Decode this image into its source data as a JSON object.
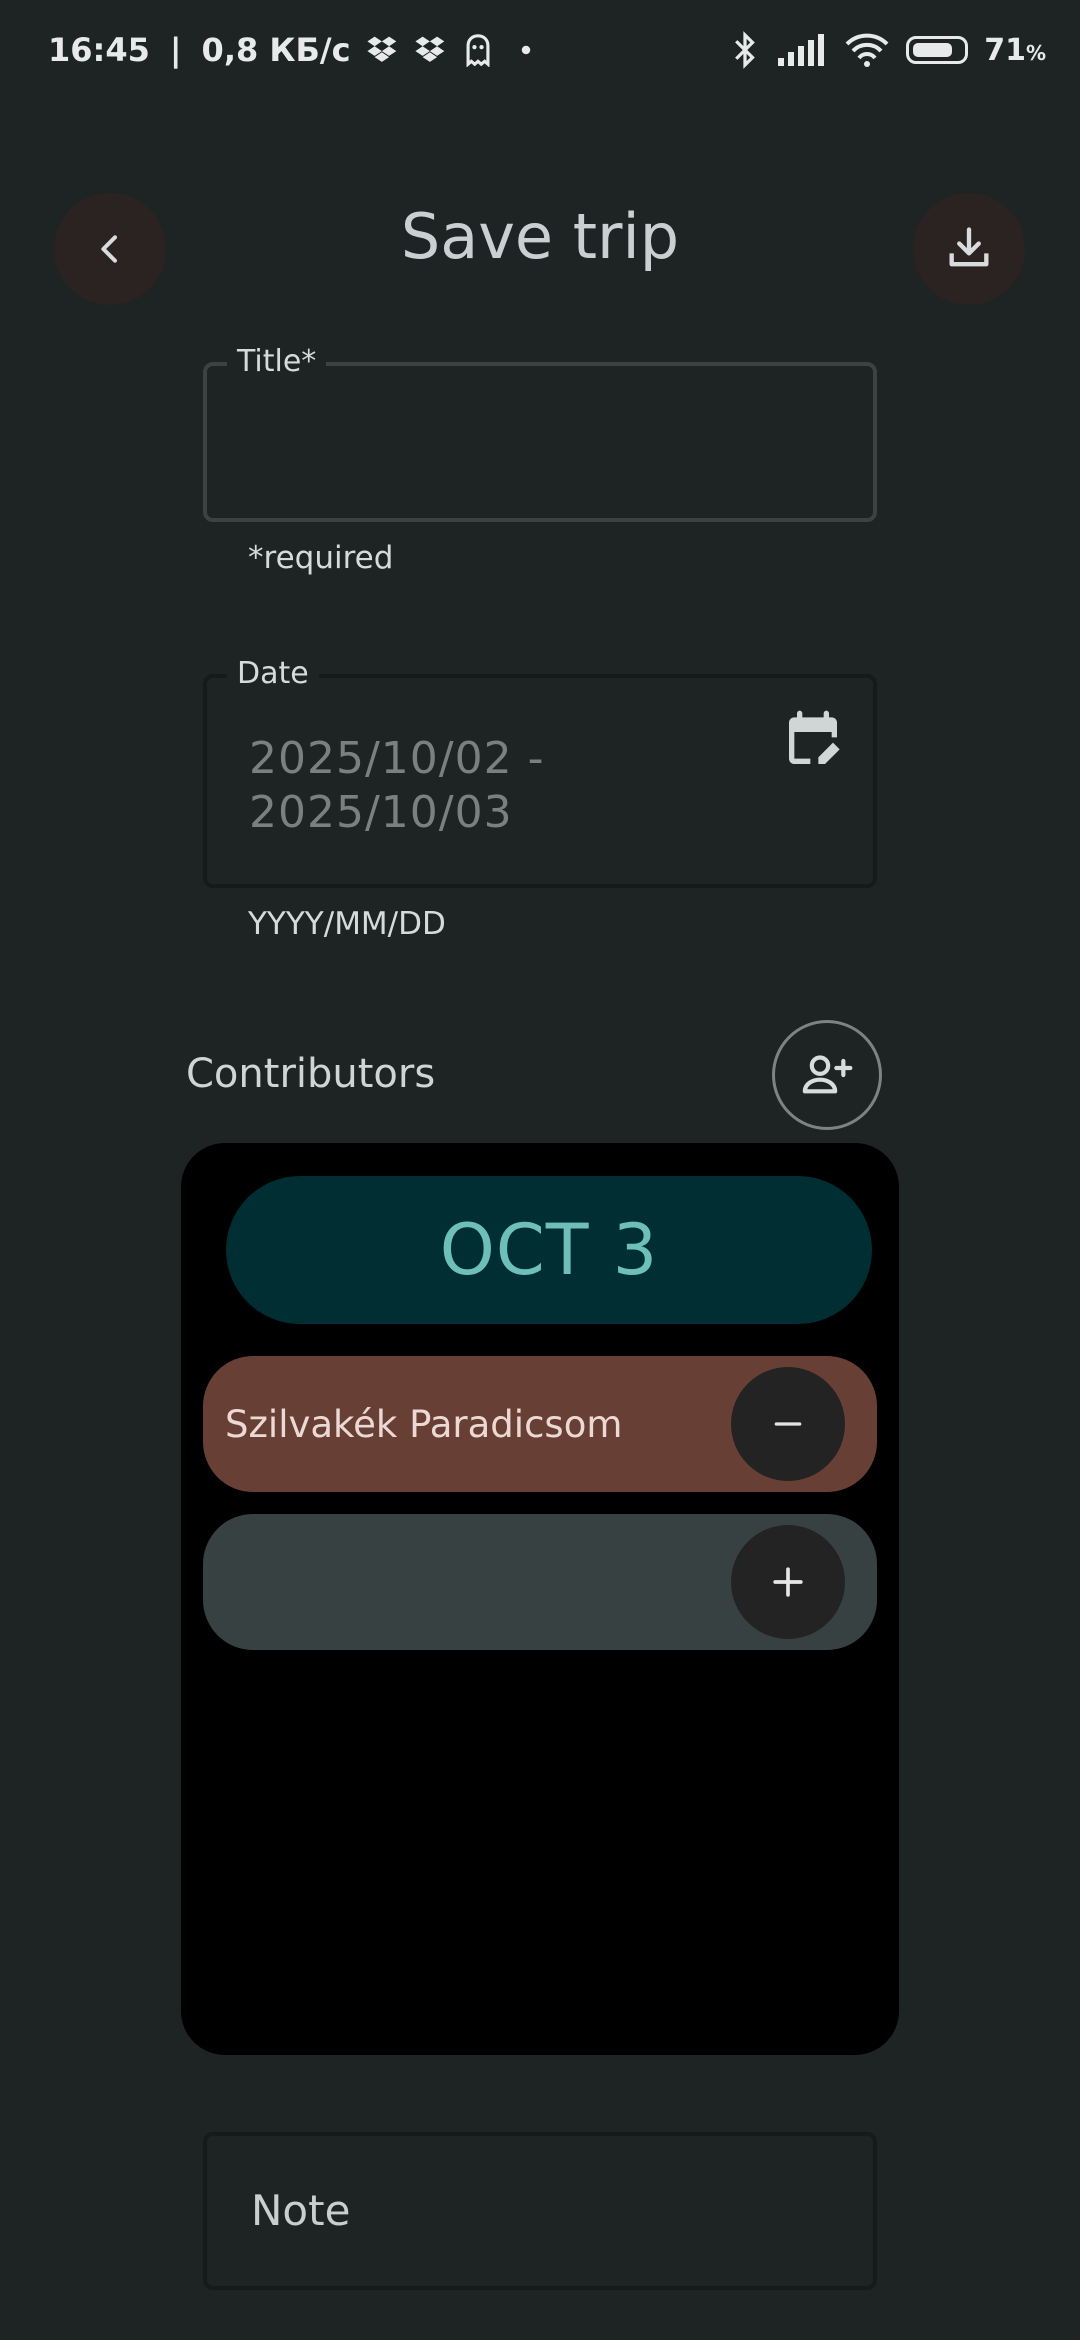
{
  "status_bar": {
    "time": "16:45",
    "separator": "|",
    "network_speed": "0,8 КБ/с",
    "battery_level": "71",
    "battery_unit": "%",
    "icons": [
      "dropbox-icon",
      "dropbox-icon",
      "ghost-icon",
      "dot-icon",
      "bluetooth-icon",
      "signal-icon",
      "wifi-icon",
      "battery-icon"
    ]
  },
  "header": {
    "title": "Save trip",
    "back_icon": "chevron-left-icon",
    "download_icon": "download-icon"
  },
  "title_field": {
    "label": "Title*",
    "value": "",
    "helper": "*required"
  },
  "date_field": {
    "label": "Date",
    "value_line1": "2025/10/02 -",
    "value_line2": "2025/10/03",
    "helper": "YYYY/MM/DD",
    "icon": "calendar-edit-icon"
  },
  "contributors": {
    "title": "Contributors",
    "add_icon": "person-add-icon",
    "date_chip": "OCT 3",
    "rows": [
      {
        "name": "Szilvakék Paradicsom",
        "action_icon": "minus-icon"
      },
      {
        "name": "",
        "action_icon": "plus-icon"
      }
    ]
  },
  "note_field": {
    "label": "Note"
  },
  "colors": {
    "background": "#1e2424",
    "chip_bg": "#002e33",
    "chip_text": "#6fbfb9",
    "row_filled": "#683f35",
    "row_empty": "#384142"
  }
}
